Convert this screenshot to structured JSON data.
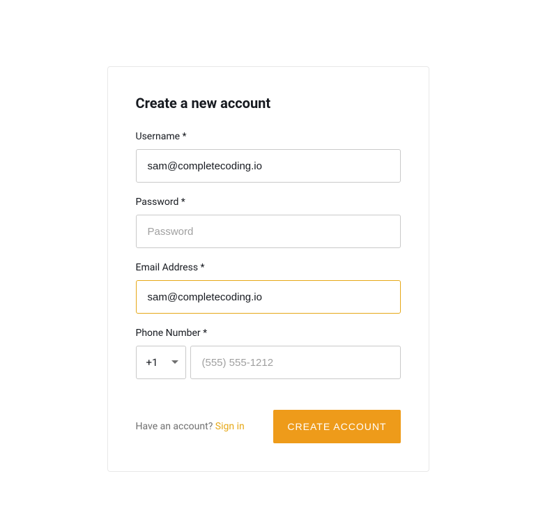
{
  "title": "Create a new account",
  "fields": {
    "username": {
      "label": "Username *",
      "value": "sam@completecoding.io",
      "placeholder": ""
    },
    "password": {
      "label": "Password *",
      "value": "",
      "placeholder": "Password"
    },
    "email": {
      "label": "Email Address *",
      "value": "sam@completecoding.io",
      "placeholder": ""
    },
    "phone": {
      "label": "Phone Number *",
      "dial_code": "+1",
      "value": "",
      "placeholder": "(555) 555-1212"
    }
  },
  "footer": {
    "have_account": "Have an account? ",
    "sign_in": "Sign in",
    "create_button": "CREATE ACCOUNT"
  },
  "colors": {
    "accent": "#ee9b1a",
    "focus_border": "#e6a817",
    "text": "#16191f"
  }
}
